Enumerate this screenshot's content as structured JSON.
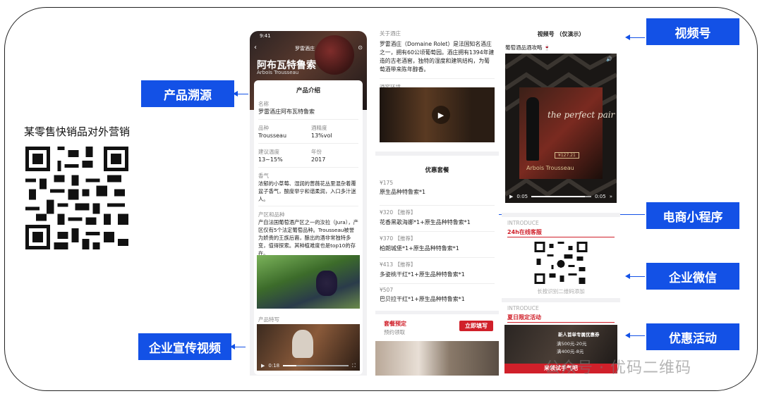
{
  "left": {
    "title": "某零售快销品对外营销"
  },
  "tags": {
    "trace": "产品溯源",
    "video": "企业宣传视频",
    "channel": "视频号",
    "mini": "电商小程序",
    "wecom": "企业微信",
    "promo": "优惠活动"
  },
  "phone1": {
    "time": "9:41",
    "winery_short": "罗雷酒庄",
    "product_name": "阿布瓦特鲁索",
    "product_name_en": "Arbois Trousseau",
    "section_title": "产品介绍",
    "name_label": "名称",
    "name_value": "罗雷酒庄阿布瓦特鲁索",
    "variety_label": "品种",
    "variety_value": "Trousseau",
    "abv_label": "酒精度",
    "abv_value": "13%vol",
    "temp_label": "建议温度",
    "temp_value": "13~15%",
    "year_label": "年份",
    "year_value": "2017",
    "aroma_label": "香气",
    "aroma_text": "浓郁的小草莓、湿润的蔷薇花丛里混杂着覆盆子香气，酸度举宁和谐柔润，入口多汁迷人。",
    "origin_label": "产区和品种",
    "origin_text": "产自法国葡萄酒产区之一的汝拉（Jura），产区仅有5个法定葡萄品种。Trousseau被誉为娇贵的王族后裔，酿出的酒非常独特多变，值得探索。其种植难度也是top10的存在。",
    "feature_label": "产品特写",
    "video_time": "0:18"
  },
  "phone2": {
    "about_label": "关于酒庄",
    "about_text": "罗雷酒庄（Domaine Rolet）是法国知名酒庄之一，拥有60公顷葡萄园。酒庄拥有1394年建造的古老酒窖，独特的湿度和建筑结构，为葡萄酒带来陈年醇香。",
    "env_label": "酒窖环境",
    "package_title": "优惠套餐",
    "packages": [
      {
        "price": "¥175",
        "name": "原生品种特鲁索*1"
      },
      {
        "price": "¥320 【推荐】",
        "name": "花香黑歌海娜*1+原生品种特鲁索*1"
      },
      {
        "price": "¥370 【推荐】",
        "name": "柏朗城堡*1+原生品种特鲁索*1"
      },
      {
        "price": "¥413 【推荐】",
        "name": "多姿桃干红*1+原生品种特鲁索*1"
      },
      {
        "price": "¥507",
        "name": "巴贝拉干红*1+原生品种特鲁索*1"
      }
    ],
    "reserve_title": "套餐预定",
    "reserve_sub": "预约领取",
    "reserve_btn": "立即填写"
  },
  "phone3": {
    "header": "视频号 （仅演示）",
    "account": "葡萄酒品酒攻略 🍷",
    "video_script": "the perfect pair",
    "video_badge": "¥127.21",
    "video_brand": "Arbois Trousseau",
    "time_start": "0:05",
    "time_end": "0:05",
    "introduce1": "INTRODUCE",
    "service_title": "24h在线客服",
    "qr_hint": "长按识别二维码添加",
    "introduce2": "INTRODUCE",
    "promo_title": "夏日限定活动",
    "coupon_title": "新人首单专属优惠券",
    "coupon1": "满500元-20元",
    "coupon2": "满400元-8元",
    "coupon_btn": "来领试手气吧"
  },
  "watermark": "公众号 · 优码二维码",
  "colors": {
    "accent": "#1351e6",
    "red": "#d0202a"
  }
}
